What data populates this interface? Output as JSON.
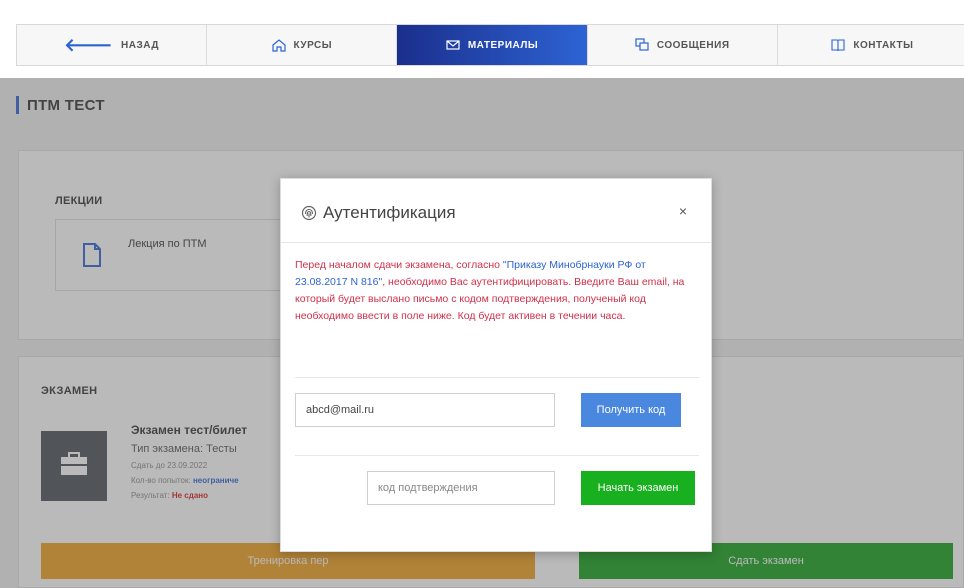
{
  "nav": {
    "items": [
      {
        "label": "НАЗАД",
        "icon": "arrow-left-icon"
      },
      {
        "label": "КУРСЫ",
        "icon": "home-icon"
      },
      {
        "label": "МАТЕРИАЛЫ",
        "icon": "mail-icon",
        "active": true
      },
      {
        "label": "СООБЩЕНИЯ",
        "icon": "chat-icon"
      },
      {
        "label": "КОНТАКТЫ",
        "icon": "book-icon"
      }
    ]
  },
  "page": {
    "title": "ПТМ ТЕСТ"
  },
  "lectures": {
    "label": "ЛЕКЦИИ",
    "items": [
      {
        "title": "Лекция по ПТМ"
      }
    ]
  },
  "exam": {
    "label": "ЭКЗАМЕН",
    "name": "Экзамен тест/билет",
    "type": "Тип экзамена: Тесты",
    "deadline": "Сдать до 23.09.2022",
    "attempts_label": "Кол-во попыток:",
    "attempts_value": "неограниче",
    "result_label": "Результат:",
    "result_value": "Не сдано",
    "train_button": "Тренировка пер",
    "pass_button": "Сдать экзамен"
  },
  "modal": {
    "title": "Аутентификация",
    "close": "×",
    "message_part1": "Перед началом сдачи экзамена, согласно ",
    "message_link": "\"Приказу Минобрнауки РФ от 23.08.2017 N 816\"",
    "message_part2": ", необходимо Вас аутентифицировать. Введите Ваш email, на который будет выслано письмо с кодом подтверждения, полученый код необходимо ввести в поле ниже. Код будет активен в течении часа.",
    "email_value": "abcd@mail.ru",
    "get_code_button": "Получить код",
    "code_placeholder": "код подтверждения",
    "start_button": "Начать экзамен"
  },
  "colors": {
    "accent": "#2d63d4",
    "nav_active_start": "#1b2f8c",
    "message": "#d0304a",
    "get_code": "#4a88e0",
    "start": "#18b01e",
    "train": "#f0a020",
    "pass": "#16a01c"
  }
}
